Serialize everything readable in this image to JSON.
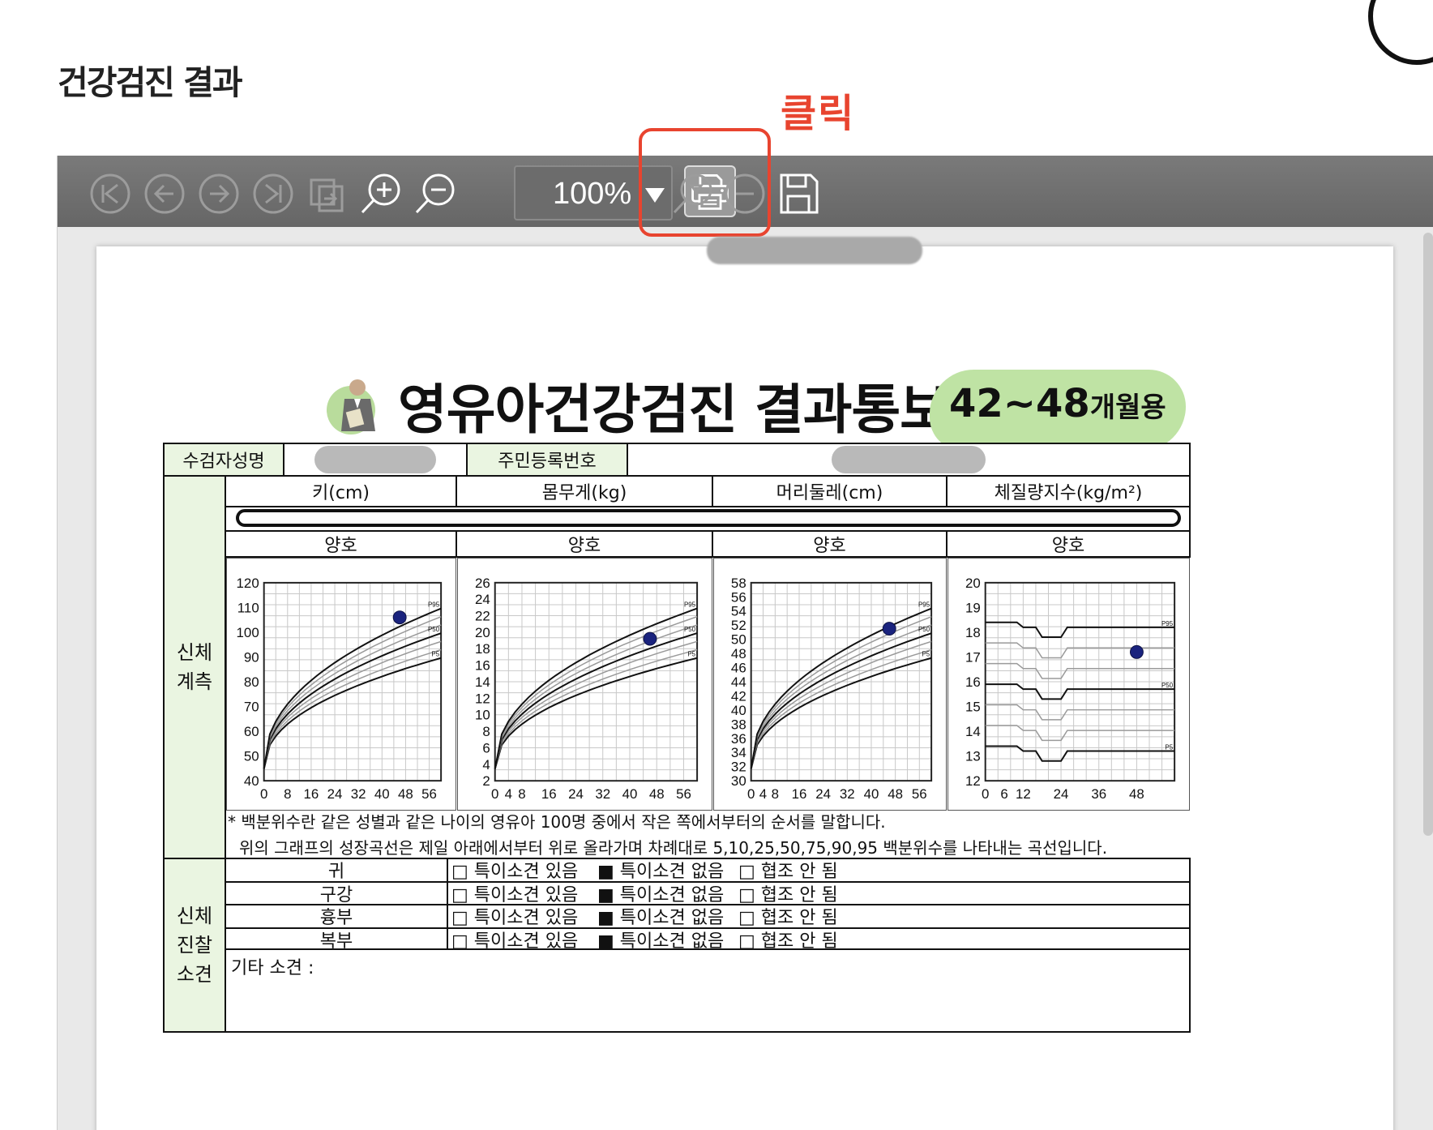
{
  "page": {
    "title": "건강검진 결과"
  },
  "annotation": {
    "click_label": "클릭",
    "color": "#e8442f"
  },
  "toolbar": {
    "zoom_value": "100%",
    "buttons": [
      "first-page-icon",
      "prev-page-icon",
      "next-page-icon",
      "last-page-icon",
      "export-icon",
      "zoom-in-icon",
      "zoom-out-icon",
      "print-icon",
      "find-icon",
      "minus-icon",
      "save-icon"
    ]
  },
  "document": {
    "title": "영유아건강검진 결과통보서",
    "age_badge_main": "42~48",
    "age_badge_suffix": "개월용",
    "patient_name_label": "수검자성명",
    "rrn_label": "주민등록번호",
    "measure_section_label_1": "신체",
    "measure_section_label_2": "계측",
    "columns": [
      "키(cm)",
      "몸무게(kg)",
      "머리둘레(cm)",
      "체질량지수(kg/m²)"
    ],
    "results": [
      "양호",
      "양호",
      "양호",
      "양호"
    ],
    "note_1": "* 백분위수란 같은 성별과 같은 나이의 영유아 100명 중에서 작은 쪽에서부터의 순서를 말합니다.",
    "note_2": "위의 그래프의 성장곡선은 제일 아래에서부터 위로 올라가며 차례대로 5,10,25,50,75,90,95 백분위수를 나타내는 곡선입니다.",
    "exam_section_label_1": "신체",
    "exam_section_label_2": "진찰",
    "exam_section_label_3": "소견",
    "exam_rows": [
      {
        "label": "귀"
      },
      {
        "label": "구강"
      },
      {
        "label": "흉부"
      },
      {
        "label": "복부"
      }
    ],
    "option_1": "□ 특이소견  있음",
    "option_2": "■ 특이소견 없음",
    "option_3": "□ 협조 안 됨",
    "other_findings": "기타 소견 :"
  },
  "chart_data": [
    {
      "type": "line",
      "title": "키(cm)",
      "x_ticks": [
        "0",
        "8",
        "16",
        "24",
        "32",
        "40",
        "48",
        "56"
      ],
      "y_ticks": [
        "40",
        "50",
        "60",
        "70",
        "80",
        "90",
        "100",
        "110",
        "120"
      ],
      "xlim": [
        0,
        60
      ],
      "ylim": [
        40,
        120
      ],
      "series_labels": [
        "P95",
        "P50",
        "P5"
      ],
      "point": {
        "x": 46,
        "y": 106
      }
    },
    {
      "type": "line",
      "title": "몸무게(kg)",
      "x_ticks": [
        "0",
        "4",
        "8",
        "16",
        "24",
        "32",
        "40",
        "48",
        "56"
      ],
      "y_ticks": [
        "2",
        "4",
        "6",
        "8",
        "10",
        "12",
        "14",
        "16",
        "18",
        "20",
        "22",
        "24",
        "26"
      ],
      "xlim": [
        0,
        60
      ],
      "ylim": [
        2,
        26
      ],
      "series_labels": [
        "P95",
        "P50",
        "P5"
      ],
      "point": {
        "x": 46,
        "y": 19.2
      }
    },
    {
      "type": "line",
      "title": "머리둘레(cm)",
      "x_ticks": [
        "0",
        "4",
        "8",
        "16",
        "24",
        "32",
        "40",
        "48",
        "56"
      ],
      "y_ticks": [
        "30",
        "32",
        "34",
        "36",
        "38",
        "40",
        "42",
        "44",
        "46",
        "48",
        "50",
        "52",
        "54",
        "56",
        "58"
      ],
      "xlim": [
        0,
        60
      ],
      "ylim": [
        30,
        58
      ],
      "series_labels": [
        "P95",
        "P50",
        "P5"
      ],
      "point": {
        "x": 46,
        "y": 51.5
      }
    },
    {
      "type": "line",
      "title": "체질량지수(kg/m²)",
      "x_ticks": [
        "0",
        "6",
        "12",
        "24",
        "36",
        "48"
      ],
      "y_ticks": [
        "12",
        "13",
        "14",
        "15",
        "16",
        "17",
        "18",
        "19",
        "20"
      ],
      "xlim": [
        0,
        60
      ],
      "ylim": [
        12,
        20
      ],
      "series_labels": [
        "P95",
        "P50",
        "P5"
      ],
      "point": {
        "x": 48,
        "y": 17.2
      }
    }
  ]
}
